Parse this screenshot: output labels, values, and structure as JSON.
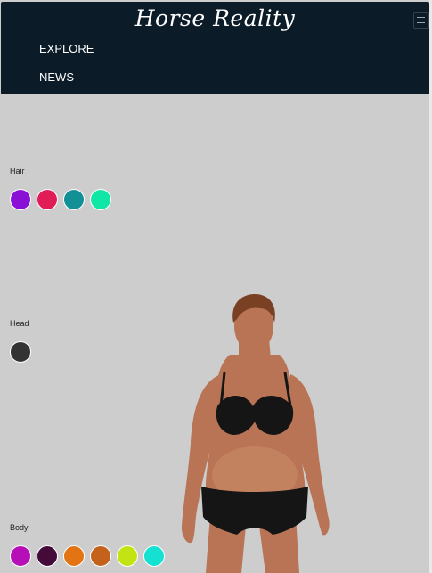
{
  "header": {
    "brand": "Horse Reality",
    "nav": [
      {
        "label": "EXPLORE"
      },
      {
        "label": "NEWS"
      }
    ],
    "toggle_icon": "hamburger-menu-icon"
  },
  "sections": {
    "hair": {
      "label": "Hair",
      "colors": [
        "#8a10d6",
        "#e01d57",
        "#138f96",
        "#10e7a6"
      ]
    },
    "head": {
      "label": "Head",
      "colors": [
        "#333333"
      ]
    },
    "body": {
      "label": "Body",
      "colors": [
        "#b70fb8",
        "#440a3a",
        "#e37414",
        "#c4621b",
        "#c3e313",
        "#14e1d1"
      ]
    }
  },
  "colors": {
    "navbar": "#0b1b28",
    "background": "#cdcdcd",
    "skin": "#b87454",
    "underwear": "#151515"
  }
}
